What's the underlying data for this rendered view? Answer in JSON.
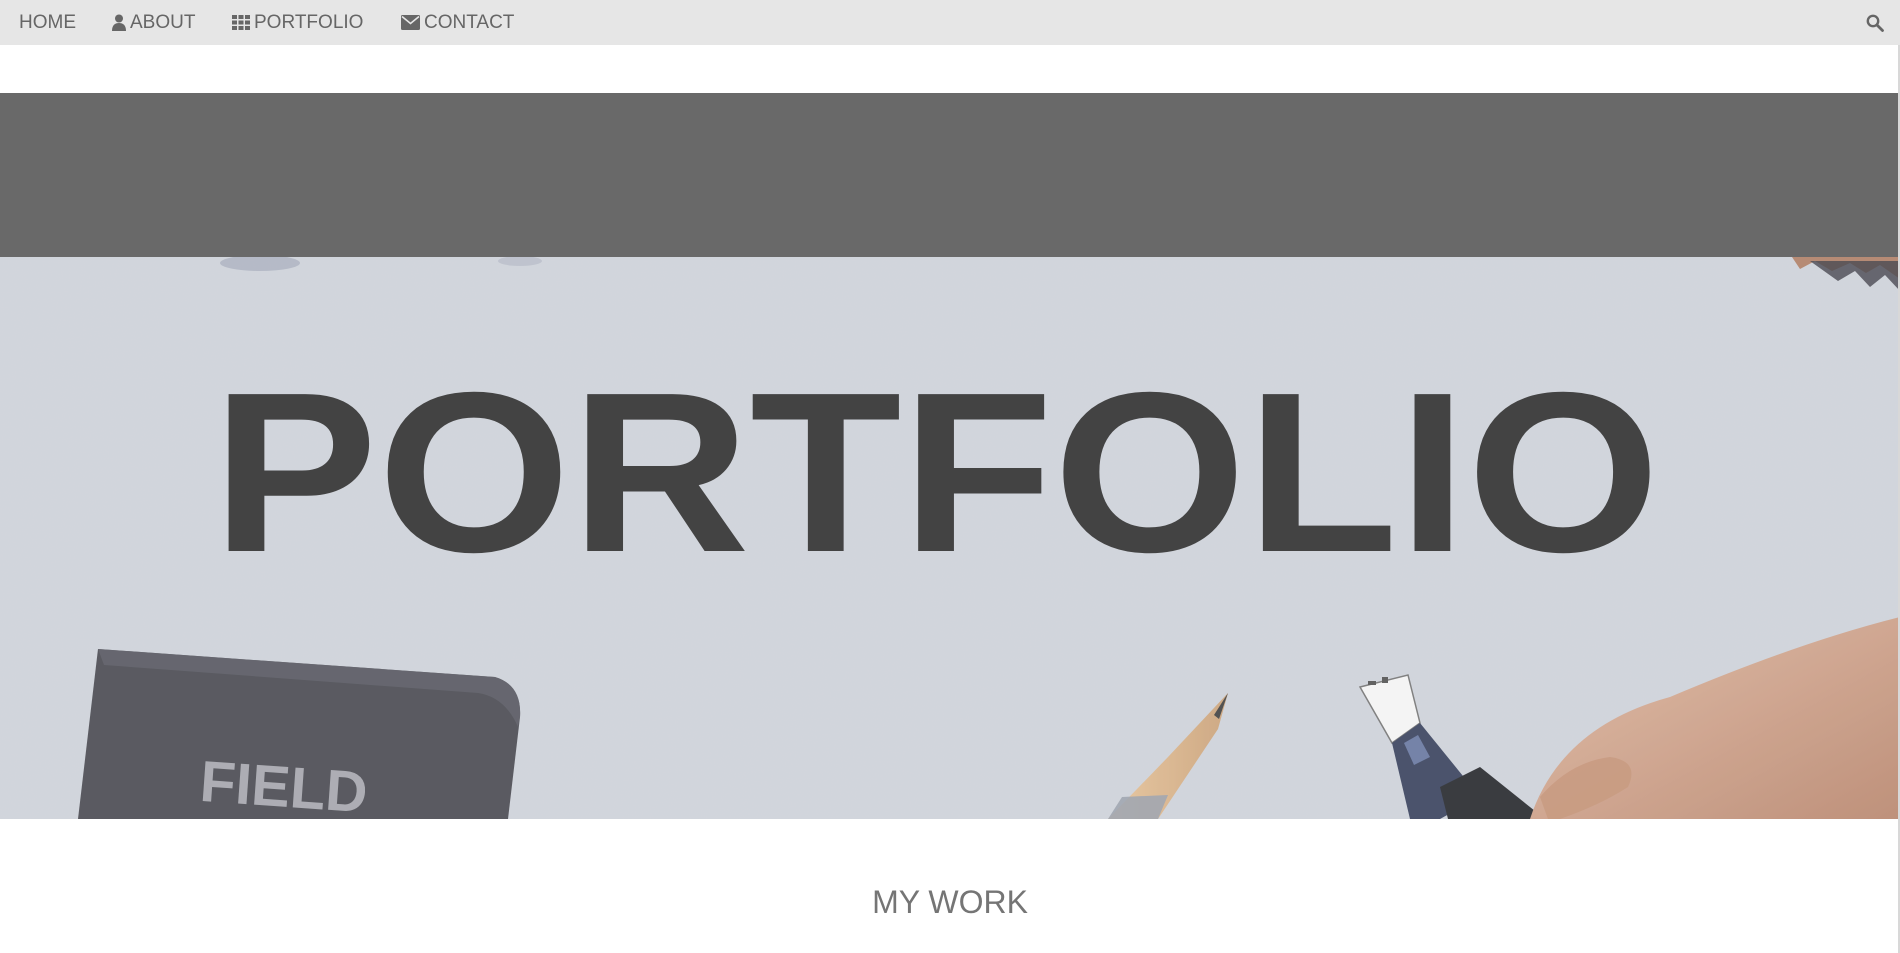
{
  "nav": {
    "home": "HOME",
    "about": "ABOUT",
    "portfolio": "PORTFOLIO",
    "contact": "CONTACT",
    "icons": {
      "about": "user-icon",
      "portfolio": "grid-icon",
      "contact": "envelope-icon",
      "search": "search-icon"
    }
  },
  "hero": {
    "headline": "PORTFOLIO",
    "notebook_text": "FIELD"
  },
  "section": {
    "title": "MY WORK"
  },
  "colors": {
    "nav_bg": "#e6e6e6",
    "nav_text": "#666666",
    "band": "#696969",
    "hero_paper": "#c4c8d0",
    "headline": "#333333",
    "section_title": "#757575"
  }
}
